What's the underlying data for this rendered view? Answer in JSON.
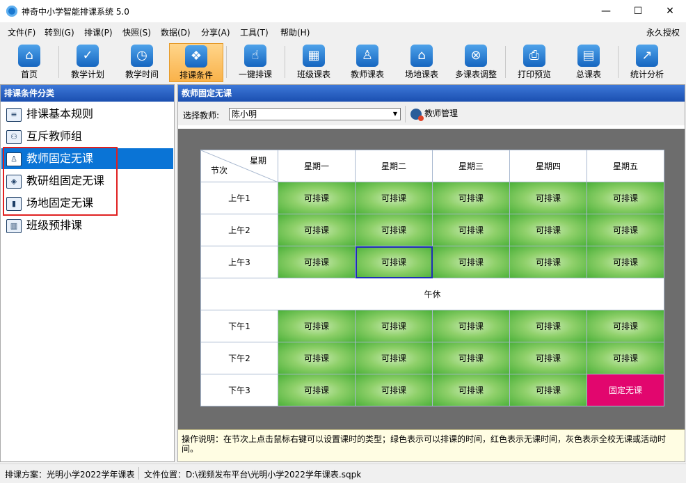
{
  "window": {
    "title": "神奇中小学智能排课系统 5.0",
    "controls": [
      "—",
      "☐",
      "✕"
    ]
  },
  "menubar": {
    "items": [
      "文件(F)",
      "转到(G)",
      "排课(P)",
      "快照(S)",
      "数据(D)",
      "分享(A)",
      "工具(T)",
      "帮助(H)"
    ],
    "right_label": "永久授权"
  },
  "toolbar": {
    "buttons": [
      {
        "label": "首页",
        "icon": "home-icon",
        "glyph": "⌂"
      },
      {
        "label": "教学计划",
        "icon": "clipboard-check-icon",
        "glyph": "✓"
      },
      {
        "label": "教学时间",
        "icon": "clock-icon",
        "glyph": "◷"
      },
      {
        "label": "排课条件",
        "icon": "cubes-icon",
        "glyph": "❖",
        "active": true
      },
      {
        "label": "一键排课",
        "icon": "hand-pointer-icon",
        "glyph": "☝"
      },
      {
        "label": "班级课表",
        "icon": "calendar-grid-icon",
        "glyph": "▦"
      },
      {
        "label": "教师课表",
        "icon": "teacher-card-icon",
        "glyph": "♙"
      },
      {
        "label": "场地课表",
        "icon": "school-building-icon",
        "glyph": "⌂"
      },
      {
        "label": "多课表调整",
        "icon": "multi-schedule-icon",
        "glyph": "⊗"
      },
      {
        "label": "打印预览",
        "icon": "printer-icon",
        "glyph": "⎙"
      },
      {
        "label": "总课表",
        "icon": "master-calendar-icon",
        "glyph": "▤"
      },
      {
        "label": "统计分析",
        "icon": "bar-chart-icon",
        "glyph": "↗"
      }
    ]
  },
  "left_panel": {
    "header": "排课条件分类",
    "items": [
      {
        "label": "排课基本规则",
        "icon": "rules-icon",
        "glyph": "≡"
      },
      {
        "label": "互斥教师组",
        "icon": "exclusive-teachers-icon",
        "glyph": "⚇"
      },
      {
        "label": "教师固定无课",
        "icon": "teacher-icon",
        "glyph": "♙",
        "selected": true
      },
      {
        "label": "教研组固定无课",
        "icon": "cube-icon",
        "glyph": "◈"
      },
      {
        "label": "场地固定无课",
        "icon": "room-icon",
        "glyph": "▮"
      },
      {
        "label": "班级预排课",
        "icon": "book-icon",
        "glyph": "▥"
      }
    ]
  },
  "right_panel": {
    "header": "教师固定无课",
    "select_label": "选择教师:",
    "selected_teacher": "陈小明",
    "teacher_manage_label": "教师管理",
    "corner_top": "星期",
    "corner_bottom": "节次",
    "days": [
      "星期一",
      "星期二",
      "星期三",
      "星期四",
      "星期五"
    ],
    "lunch_label": "午休",
    "periods": [
      {
        "label": "上午1",
        "cells": [
          "可排课",
          "可排课",
          "可排课",
          "可排课",
          "可排课"
        ]
      },
      {
        "label": "上午2",
        "cells": [
          "可排课",
          "可排课",
          "可排课",
          "可排课",
          "可排课"
        ]
      },
      {
        "label": "上午3",
        "cells": [
          "可排课",
          "可排课",
          "可排课",
          "可排课",
          "可排课"
        ]
      },
      {
        "label": "下午1",
        "cells": [
          "可排课",
          "可排课",
          "可排课",
          "可排课",
          "可排课"
        ]
      },
      {
        "label": "下午2",
        "cells": [
          "可排课",
          "可排课",
          "可排课",
          "可排课",
          "可排课"
        ]
      },
      {
        "label": "下午3",
        "cells": [
          "可排课",
          "可排课",
          "可排课",
          "可排课",
          "固定无课"
        ]
      }
    ],
    "colors": {
      "available": "#4cb13a",
      "blocked": "#e2066e",
      "focus": "#1d2fb5"
    },
    "instructions": "操作说明：在节次上点击鼠标右键可以设置课时的类型；绿色表示可以排课的时间，红色表示无课时间，灰色表示全校无课或活动时间。"
  },
  "statusbar": {
    "plan": "排课方案：光明小学2022学年课表",
    "file": "文件位置：D:\\视频发布平台\\光明小学2022学年课表.sqpk"
  }
}
